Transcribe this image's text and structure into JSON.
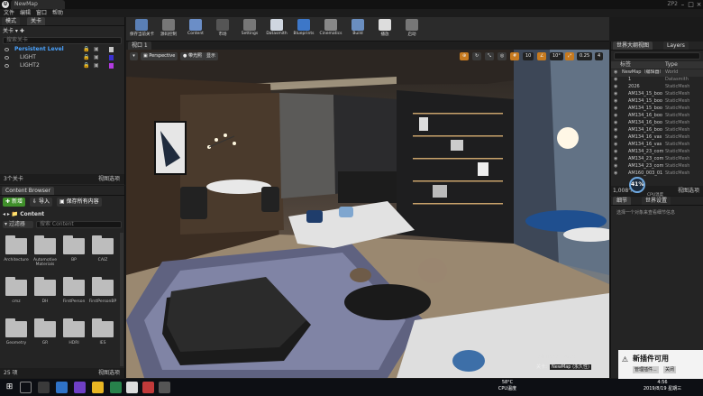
{
  "titlebar": {
    "tab_title": "NewMap",
    "project": "ZP2"
  },
  "menu": [
    "文件",
    "编辑",
    "窗口",
    "帮助"
  ],
  "modes_panel": {
    "tabs": [
      "模式",
      "关卡"
    ],
    "search_placeholder": "搜索关卡",
    "title": "关卡",
    "levels": [
      {
        "name": "Persistent Level",
        "color": "#4aa3ff"
      },
      {
        "name": "LIGHT",
        "color": "#3a30d0"
      },
      {
        "name": "LIGHT2",
        "color": "#b23be0"
      }
    ],
    "footer_count": "3个关卡",
    "view_options": "视图选项"
  },
  "content_browser": {
    "tab": "Content Browser",
    "add_new": "新增",
    "import": "导入",
    "save_all": "保存所有内容",
    "path": "Content",
    "filter": "过滤器",
    "search_placeholder": "搜索 Content",
    "folders": [
      "Architecture",
      "Automotive Materials",
      "BP",
      "CAIZ",
      "cmz",
      "DH",
      "FirstPerson",
      "FirstPersonBP",
      "Geometry",
      "GR",
      "HDRI",
      "IES"
    ],
    "footer_count": "25 项",
    "view_options": "视图选项"
  },
  "toolbar": [
    {
      "label": "保存当前关卡",
      "color": "#5a7fb5"
    },
    {
      "label": "源码控制",
      "color": "#777"
    },
    {
      "label": "Content",
      "color": "#6b8ec7"
    },
    {
      "label": "市场",
      "color": "#555"
    },
    {
      "label": "Settings",
      "color": "#777"
    },
    {
      "label": "Datasmith",
      "color": "#cfd6e0"
    },
    {
      "label": "Blueprints",
      "color": "#3d77c8"
    },
    {
      "label": "Cinematics",
      "color": "#888"
    },
    {
      "label": "Build",
      "color": "#6a8ec0"
    },
    {
      "label": "播放",
      "color": "#ddd"
    },
    {
      "label": "启动",
      "color": "#777"
    }
  ],
  "viewport": {
    "tab": "视口 1",
    "perspective": "Perspective",
    "lit": "带光照",
    "show": "显示",
    "snap_values": [
      "10",
      "10°",
      "0.25",
      "4"
    ],
    "scale_label": "屏幕百分比：200%",
    "level_label": "关卡：",
    "level_name": "NewMap (永久性)"
  },
  "outliner": {
    "tabs": [
      "世界大纲视图",
      "Layers"
    ],
    "col_label": "标签",
    "col_type": "Type",
    "rows": [
      {
        "name": "NewMap（编辑器）",
        "type": "World"
      },
      {
        "name": "1",
        "type": "Datasmith"
      },
      {
        "name": "2026",
        "type": "StaticMesh"
      },
      {
        "name": "AM134_15_boo",
        "type": "StaticMesh"
      },
      {
        "name": "AM134_15_boo",
        "type": "StaticMesh"
      },
      {
        "name": "AM134_15_boo",
        "type": "StaticMesh"
      },
      {
        "name": "AM134_16_boo",
        "type": "StaticMesh"
      },
      {
        "name": "AM134_16_boo",
        "type": "StaticMesh"
      },
      {
        "name": "AM134_16_boo",
        "type": "StaticMesh"
      },
      {
        "name": "AM134_16_vas",
        "type": "StaticMesh"
      },
      {
        "name": "AM134_16_vas",
        "type": "StaticMesh"
      },
      {
        "name": "AM134_23_com",
        "type": "StaticMesh"
      },
      {
        "name": "AM134_23_com",
        "type": "StaticMesh"
      },
      {
        "name": "AM134_23_com",
        "type": "StaticMesh"
      },
      {
        "name": "AM160_003_01",
        "type": "StaticMesh"
      }
    ],
    "footer_count": "1,008个",
    "view_options": "视图选项",
    "fps": "41%",
    "gpu_label": "CPU温度"
  },
  "details": {
    "tabs": [
      "细节",
      "世界设置"
    ],
    "hint": "选择一个对象来查看细节信息"
  },
  "notification": {
    "title": "新插件可用",
    "button": "管理插件...",
    "dismiss": "关闭"
  },
  "taskbar": {
    "temp": "58°C",
    "temp_label": "CPU温度",
    "time": "4:56",
    "date": "2019/8/19 星期三"
  }
}
